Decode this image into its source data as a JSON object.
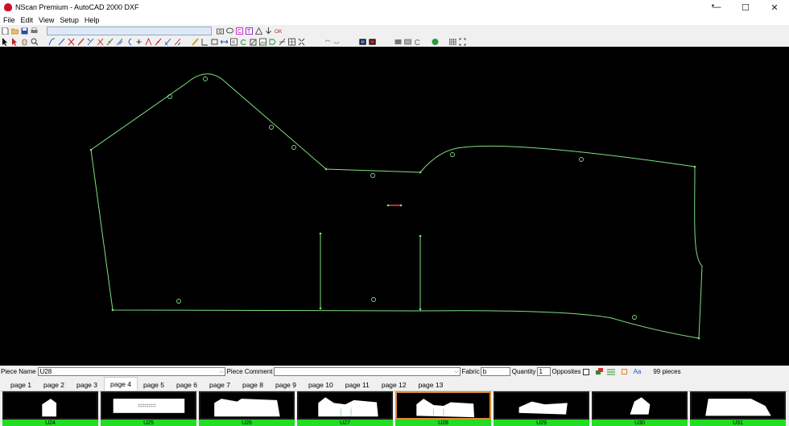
{
  "window": {
    "title": "NScan Premium - AutoCAD 2000 DXF",
    "controls": {
      "minimize": "—",
      "maximize": "☐",
      "close": "✕"
    }
  },
  "menu": {
    "items": [
      "File",
      "Edit",
      "View",
      "Setup",
      "Help"
    ],
    "small_marker": "•"
  },
  "toolbar": {
    "address": ""
  },
  "properties": {
    "piece_name_label": "Piece Name",
    "piece_name": "U28",
    "piece_comment_label": "Piece Comment",
    "piece_comment": "",
    "fabric_label": "Fabric",
    "fabric": "b",
    "quantity_label": "Quantity",
    "quantity": "1",
    "opposites_label": "Opposites",
    "pieces_count": "99 pieces",
    "aa_label": "Aa"
  },
  "tabs": [
    "page 1",
    "page 2",
    "page 3",
    "page 4",
    "page 5",
    "page 6",
    "page 7",
    "page 8",
    "page 9",
    "page 10",
    "page 11",
    "page 12",
    "page 13"
  ],
  "active_tab": "page 4",
  "thumbnails": [
    "U24",
    "U25",
    "U26",
    "U27",
    "U28",
    "U29",
    "U30",
    "U31"
  ],
  "selected_thumbnail": "U28",
  "colors": {
    "canvas": "#000000",
    "pattern_line": "#7fe07f",
    "highlight_segment": "#ff3a2a",
    "thumbnail_label_bg": "#22dd22",
    "selection_border": "#d98c33"
  }
}
